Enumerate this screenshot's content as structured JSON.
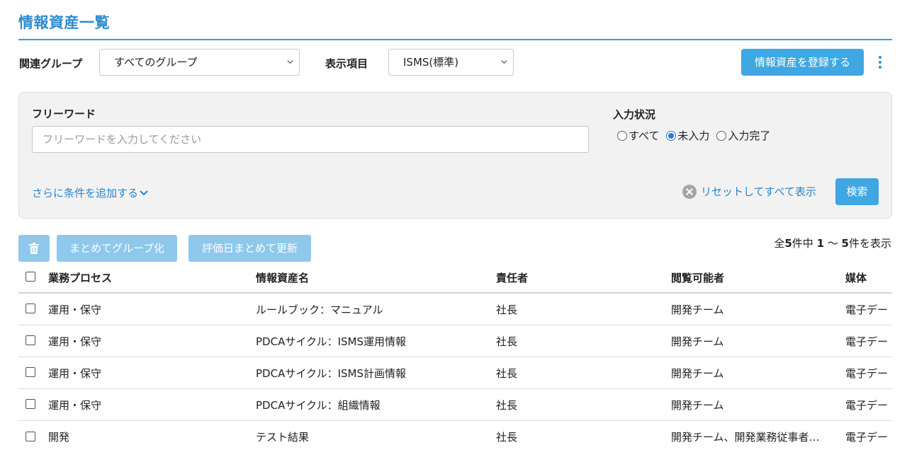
{
  "page": {
    "title": "情報資産一覧"
  },
  "toolbar": {
    "group_label": "関連グループ",
    "group_select": "すべてのグループ",
    "display_label": "表示項目",
    "display_select": "ISMS(標準)",
    "register_button": "情報資産を登録する"
  },
  "search": {
    "freeword_label": "フリーワード",
    "freeword_placeholder": "フリーワードを入力してください",
    "freeword_value": "",
    "status_label": "入力状況",
    "status_options": [
      "すべて",
      "未入力",
      "入力完了"
    ],
    "status_selected": "未入力",
    "more_conditions": "さらに条件を追加する",
    "reset_link": "リセットしてすべて表示",
    "search_button": "検索"
  },
  "actions": {
    "group_button": "まとめてグループ化",
    "update_button": "評価日まとめて更新"
  },
  "count": {
    "prefix": "全",
    "total": "5",
    "mid": "件中 ",
    "from": "1",
    "sep": " 〜 ",
    "to": "5",
    "suffix": "件を表示"
  },
  "table": {
    "headers": [
      "業務プロセス",
      "情報資産名",
      "責任者",
      "閲覧可能者",
      "媒体"
    ],
    "rows": [
      [
        "運用・保守",
        "ルールブック：マニュアル",
        "社長",
        "開発チーム",
        "電子デー"
      ],
      [
        "運用・保守",
        "PDCAサイクル：ISMS運用情報",
        "社長",
        "開発チーム",
        "電子デー"
      ],
      [
        "運用・保守",
        "PDCAサイクル：ISMS計画情報",
        "社長",
        "開発チーム",
        "電子デー"
      ],
      [
        "運用・保守",
        "PDCAサイクル：組織情報",
        "社長",
        "開発チーム",
        "電子デー"
      ],
      [
        "開発",
        "テスト結果",
        "社長",
        "開発チーム、開発業務従事者…",
        "電子デー"
      ]
    ]
  },
  "colors": {
    "accent": "#2a8ccf",
    "primary_button": "#3fa7e1",
    "disabled_button": "#8ec8ec",
    "link": "#2a85c8"
  }
}
